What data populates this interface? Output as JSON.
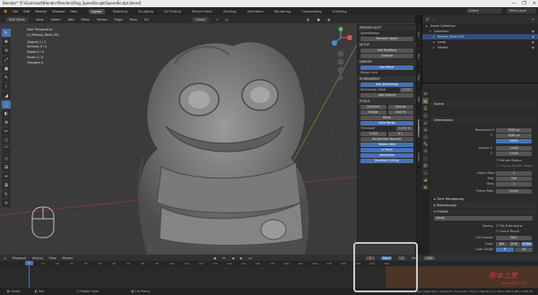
{
  "titlebar": {
    "title": "Blender* [F:\\Gumroad\\Blender\\Renders\\Pug_SpeedSculpt\\SpeedSculpt.blend]",
    "controls": [
      "—",
      "❐",
      "✕"
    ]
  },
  "menu": {
    "items": [
      "File",
      "Edit",
      "Render",
      "Window",
      "Help"
    ]
  },
  "workspaces": [
    "Layout",
    "Modeling",
    "Sculpting",
    "UV Editing",
    "Texture Paint",
    "Shading",
    "Animation",
    "Rendering",
    "Compositing",
    "Scripting"
  ],
  "topbar_right": {
    "scene": "Scene",
    "view_layer": "View Layer"
  },
  "viewport_header": {
    "mode": "Edit Mode",
    "menus": [
      "View",
      "Select",
      "Add",
      "Mesh",
      "Vertex",
      "Edge",
      "Face",
      "UV"
    ],
    "transform": "Global"
  },
  "viewport_info": {
    "view": "User Perspective",
    "object": "(1) Retopo_Mesh.001",
    "stats": [
      "Objects   1 / 2",
      "Vertices   0 / 0",
      "Edges   0 / 0",
      "Faces   0 / 0",
      "Triangles   0"
    ]
  },
  "toolbar": {
    "tools": [
      "↖",
      "✥",
      "⟲",
      "⤢",
      "▣",
      "✎",
      "⌇",
      "◢",
      "⬚",
      "◐",
      "⊕",
      "✂",
      "⬡",
      "⌒",
      "◇",
      "⊞",
      "⌖",
      "⧉",
      "↻",
      "⟡"
    ]
  },
  "npanel": {
    "addon": "SPEEDSCULPT",
    "subtitle": "SpeedRetopo",
    "remove_button": "Remove Object",
    "setup": "SETUP",
    "add_modifiers": "Add Modifiers",
    "decimate_mode": "Collapse",
    "freeze_button": "Freeze Cage",
    "mirror_label": "MIRROR",
    "mirror_btn": "Use Mirror",
    "mirror_limit": "Merge Limit",
    "shrinkwrap_label": "SHRINKWRAP",
    "shrinkwrap_btn": "Add Shrinkwrap",
    "shrinkwrap_offset": "Shrinkwrap Offset",
    "shrinkwrap_offset_val": "0.003",
    "apply_button": "Add Subsurf",
    "tools_label": "TOOLS",
    "tools_row1": [
      "Contours",
      "Spaces"
    ],
    "tools_row2": [
      "Bridge",
      "Grid Fill"
    ],
    "tools_row3": [
      "Relax"
    ],
    "auto_merge": "Auto Merge",
    "threshold_label": "Threshold",
    "threshold_val": "0.001 m",
    "xyz": [
      "0.000",
      "0.1"
    ],
    "recalc": "Recalculate Normals",
    "hidden_wire": "Hidden Wire",
    "in_front": "In Front",
    "wireframe": "Wireframe",
    "backface": "Backface Culling"
  },
  "npanel_tabs": [
    "Item",
    "Tool",
    "View",
    "Edit",
    "SpeedRetopo",
    "Create"
  ],
  "outliner": {
    "header": "Scene Collection",
    "rows": [
      {
        "icon": "▸",
        "label": "Scene Collection",
        "selected": false
      },
      {
        "icon": "▾",
        "label": "Collection",
        "selected": false
      },
      {
        "icon": "▸",
        "label": "Retopo_Mesh.001",
        "selected": true
      },
      {
        "icon": "▸",
        "label": "Lamp",
        "selected": false
      },
      {
        "icon": "▸",
        "label": "Sphere",
        "selected": false
      }
    ]
  },
  "properties": {
    "context": "Scene",
    "format": "Dimensions",
    "resolution_x_label": "Resolution X",
    "resolution_x": "1920 px",
    "resolution_y_label": "Y",
    "resolution_y": "1080 px",
    "percent": "100%",
    "aspect_x_label": "Aspect X",
    "aspect_x": "1.000",
    "aspect_y_label": "Y",
    "aspect_y": "1.000",
    "render_region": "Render Region",
    "crop_region": "Crop to Render Region",
    "frame_start_label": "Frame Start",
    "frame_start": "1",
    "frame_end_label": "End",
    "frame_end": "250",
    "frame_step_label": "Step",
    "frame_step": "1",
    "frame_rate_label": "Frame Rate",
    "frame_rate": "24 fps",
    "time_remap": "Time Remapping",
    "stereoscopy": "Stereoscopy",
    "output": "Output",
    "output_path": "/tmp\\",
    "saving_label": "Saving",
    "file_ext": "File Extensions",
    "cache_result": "Cache Result",
    "file_format_label": "File Format",
    "file_format": "PNG",
    "color_label": "Color",
    "color_opts": [
      "BW",
      "RGB",
      "RGBA"
    ],
    "color_depth_label": "Color Depth",
    "color_depth": [
      "8",
      "16"
    ],
    "compression_label": "Compression",
    "compression": "15%",
    "image_seq_label": "Image Sequence",
    "overwrite": "Overwrite",
    "placeholders": "Placeholders",
    "postproc": "Post Processing"
  },
  "timeline": {
    "menus": [
      "Playback",
      "Keying",
      "View",
      "Marker"
    ],
    "current_frame": "1",
    "start_label": "Start",
    "start": "1",
    "end_label": "End",
    "end": "250",
    "ticks": [
      "0",
      "10",
      "20",
      "30",
      "40",
      "50",
      "60",
      "70",
      "80",
      "90",
      "100",
      "110",
      "120",
      "130",
      "140",
      "150",
      "160",
      "170",
      "180",
      "190",
      "200",
      "210",
      "220",
      "230",
      "240",
      "250"
    ]
  },
  "statusbar": {
    "items": [
      "Select",
      "Box",
      "Rotate View",
      "Call Menu"
    ],
    "right": "Retopo_Mesh.001 | Verts:0/0 | Faces:0/0 | Tris:0 | Objects:1/2 | Mem: 222.5 MB | v2.80.75"
  },
  "watermark": {
    "main": "脚本之家",
    "sub": "www.jb51.net"
  }
}
